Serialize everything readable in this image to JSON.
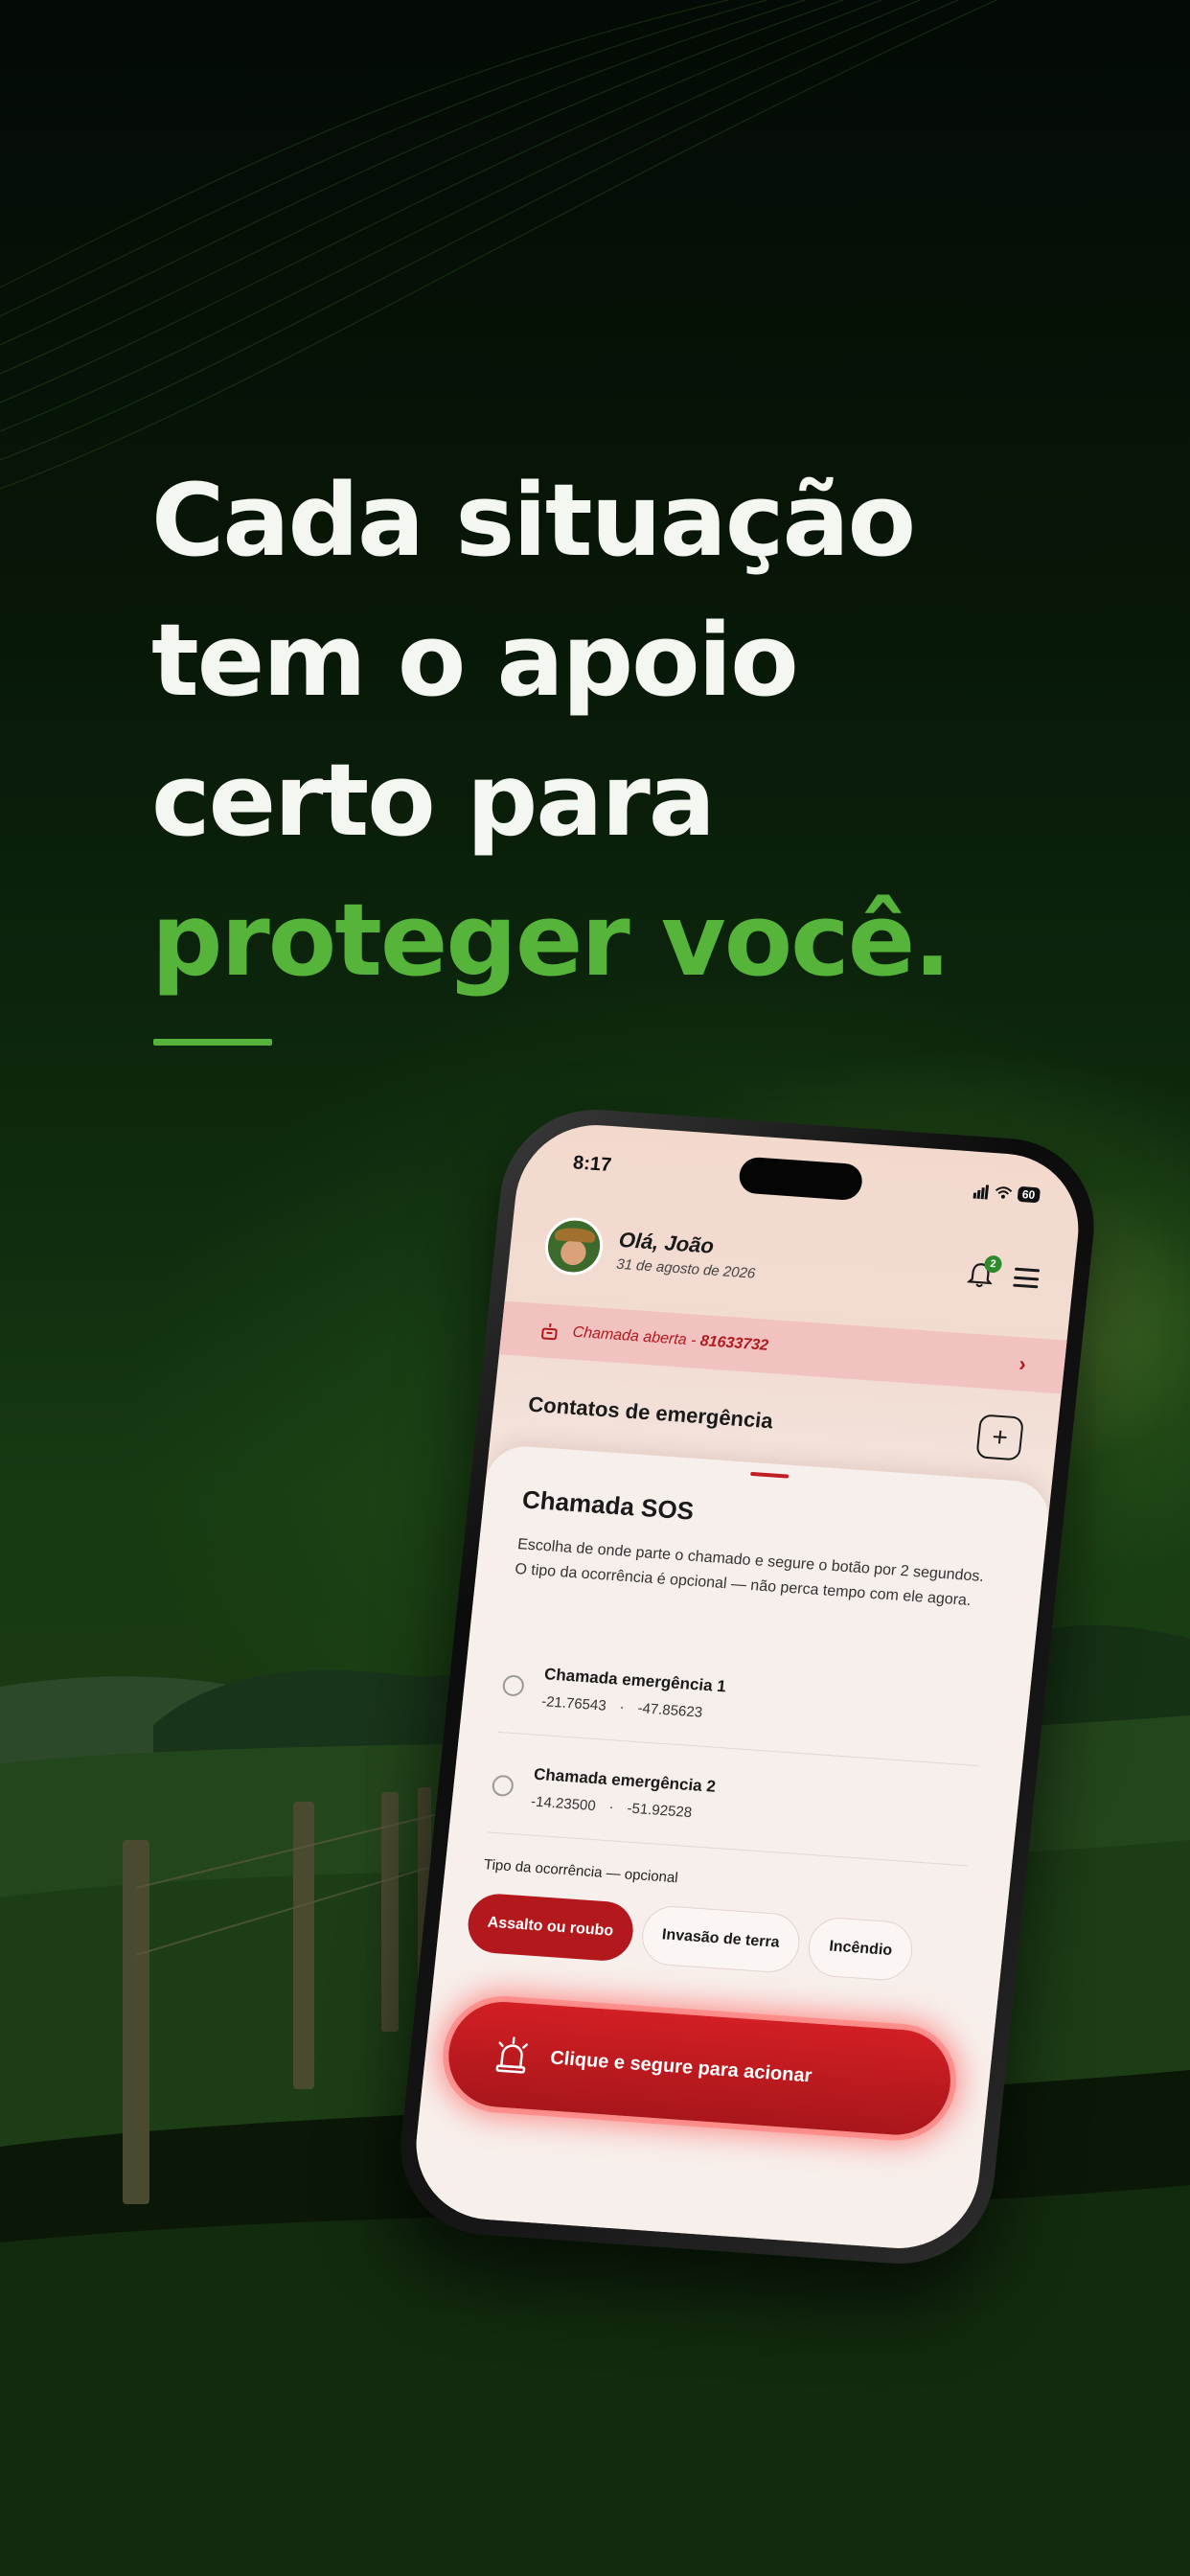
{
  "headline": {
    "line1": "Cada situação",
    "line2": "tem o apoio",
    "line3": "certo para",
    "line4_accent": "proteger você."
  },
  "colors": {
    "accent_green": "#57b43a",
    "danger_red": "#b3181d",
    "background": "#0b1f0b"
  },
  "phone": {
    "status_bar": {
      "time": "8:17",
      "battery": "60"
    },
    "header": {
      "greeting": "Olá, João",
      "date": "31 de agosto de 2026",
      "notifications_count": "2",
      "avatar_icon": "farmer-avatar",
      "bell_icon": "bell-icon",
      "menu_icon": "hamburger-menu-icon"
    },
    "open_call": {
      "label": "Chamada aberta -",
      "number": "81633732",
      "icon": "siren-icon"
    },
    "contacts": {
      "title": "Contatos de emergência",
      "add_label": "+"
    },
    "sos_sheet": {
      "title": "Chamada SOS",
      "description": "Escolha de onde parte o chamado e segure o botão por 2 segundos. O tipo da ocorrência é opcional — não perca tempo com ele agora.",
      "options": [
        {
          "title": "Chamada emergência 1",
          "lat": "-21.76543",
          "lng": "-47.85623",
          "sep": "·"
        },
        {
          "title": "Chamada emergência 2",
          "lat": "-14.23500",
          "lng": "-51.92528",
          "sep": "·"
        }
      ],
      "type_label": "Tipo da ocorrência — opcional",
      "chips": [
        {
          "label": "Assalto ou roubo",
          "selected": true
        },
        {
          "label": "Invasão de terra",
          "selected": false
        },
        {
          "label": "Incêndio",
          "selected": false
        }
      ],
      "action_button": "Clique e segure para acionar"
    }
  }
}
